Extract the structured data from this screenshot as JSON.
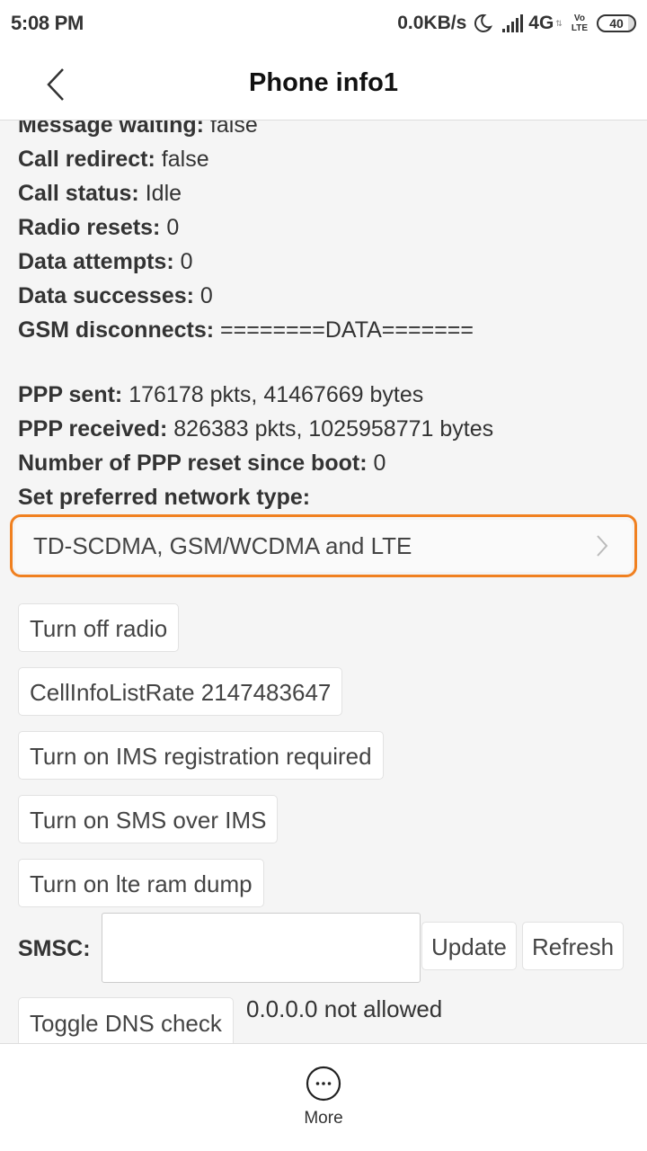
{
  "status_bar": {
    "time": "5:08 PM",
    "net_speed": "0.0KB/s",
    "network_type": "4G",
    "volte_top": "Vo",
    "volte_bottom": "LTE",
    "battery": "40",
    "icons": [
      "moon-icon",
      "signal-icon",
      "volte-icon",
      "battery-icon"
    ]
  },
  "header": {
    "title": "Phone info1",
    "back_icon": "chevron-left-icon"
  },
  "info": [
    {
      "label": "Message waiting:",
      "value": "false"
    },
    {
      "label": "Call redirect:",
      "value": "false"
    },
    {
      "label": "Call status:",
      "value": "Idle"
    },
    {
      "label": "Radio resets:",
      "value": "0"
    },
    {
      "label": "Data attempts:",
      "value": "0"
    },
    {
      "label": "Data successes:",
      "value": "0"
    },
    {
      "label": "GSM disconnects:",
      "value": "========DATA======="
    }
  ],
  "ppp": [
    {
      "label": "PPP sent:",
      "value": "176178 pkts, 41467669 bytes"
    },
    {
      "label": "PPP received:",
      "value": "826383 pkts, 1025958771 bytes"
    },
    {
      "label": "Number of PPP reset since boot:",
      "value": "0"
    }
  ],
  "network_type": {
    "label": "Set preferred network type:",
    "selected": "TD-SCDMA, GSM/WCDMA and LTE",
    "highlight_color": "#f08020"
  },
  "buttons": {
    "turn_off_radio": "Turn off radio",
    "cell_info_rate": "CellInfoListRate 2147483647",
    "ims_registration": "Turn on IMS registration required",
    "sms_over_ims": "Turn on SMS over IMS",
    "lte_ram_dump": "Turn on lte ram dump",
    "update": "Update",
    "refresh": "Refresh",
    "toggle_dns": "Toggle DNS check"
  },
  "smsc": {
    "label": "SMSC:",
    "value": "",
    "placeholder": ""
  },
  "dns_status": "0.0.0.0 not allowed",
  "bottom_bar": {
    "more_label": "More"
  }
}
